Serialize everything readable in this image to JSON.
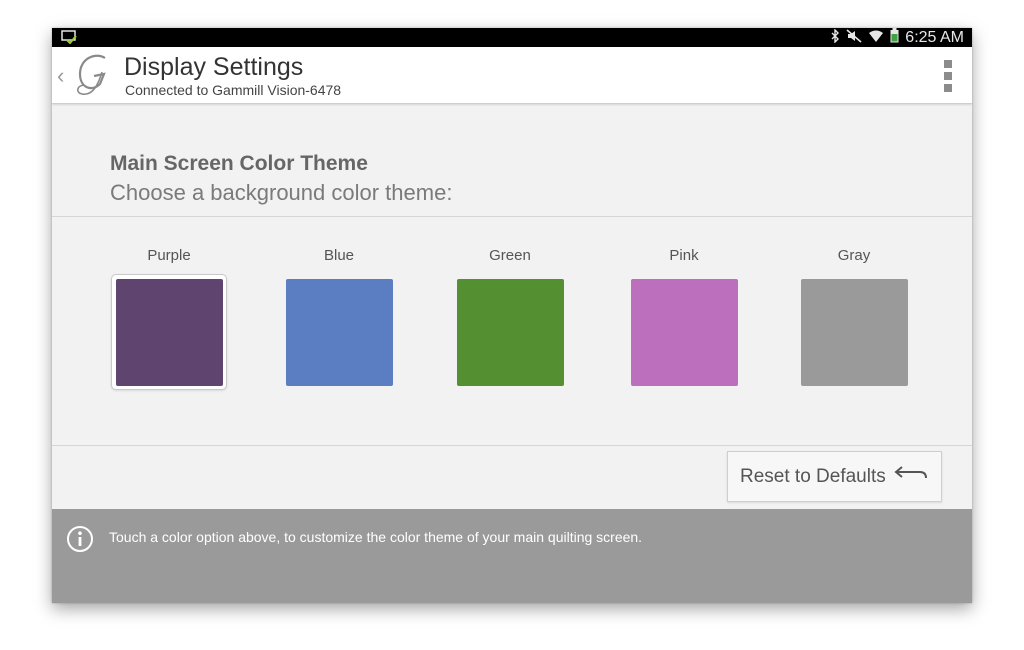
{
  "status_bar": {
    "notification_icon": "screen-notification-icon",
    "icons": [
      "bluetooth-icon",
      "mute-icon",
      "wifi-icon",
      "battery-icon"
    ],
    "time": "6:25 AM"
  },
  "action_bar": {
    "logo_icon": "gammill-g-logo",
    "title": "Display Settings",
    "subtitle": "Connected to Gammill Vision-6478",
    "overflow_icon": "overflow-menu-icon"
  },
  "section": {
    "title": "Main Screen Color Theme",
    "subtitle": "Choose a background color theme:"
  },
  "themes": [
    {
      "label": "Purple",
      "color": "#5e446f",
      "selected": true
    },
    {
      "label": "Blue",
      "color": "#5b7ec2",
      "selected": false
    },
    {
      "label": "Green",
      "color": "#548f31",
      "selected": false
    },
    {
      "label": "Pink",
      "color": "#bc6fbc",
      "selected": false
    },
    {
      "label": "Gray",
      "color": "#9a9a9a",
      "selected": false
    }
  ],
  "reset_button": {
    "label": "Reset to Defaults",
    "icon": "undo-arrow-icon"
  },
  "info": {
    "icon": "info-icon",
    "text": "Touch a color option above, to customize the color theme of your main quilting screen."
  }
}
